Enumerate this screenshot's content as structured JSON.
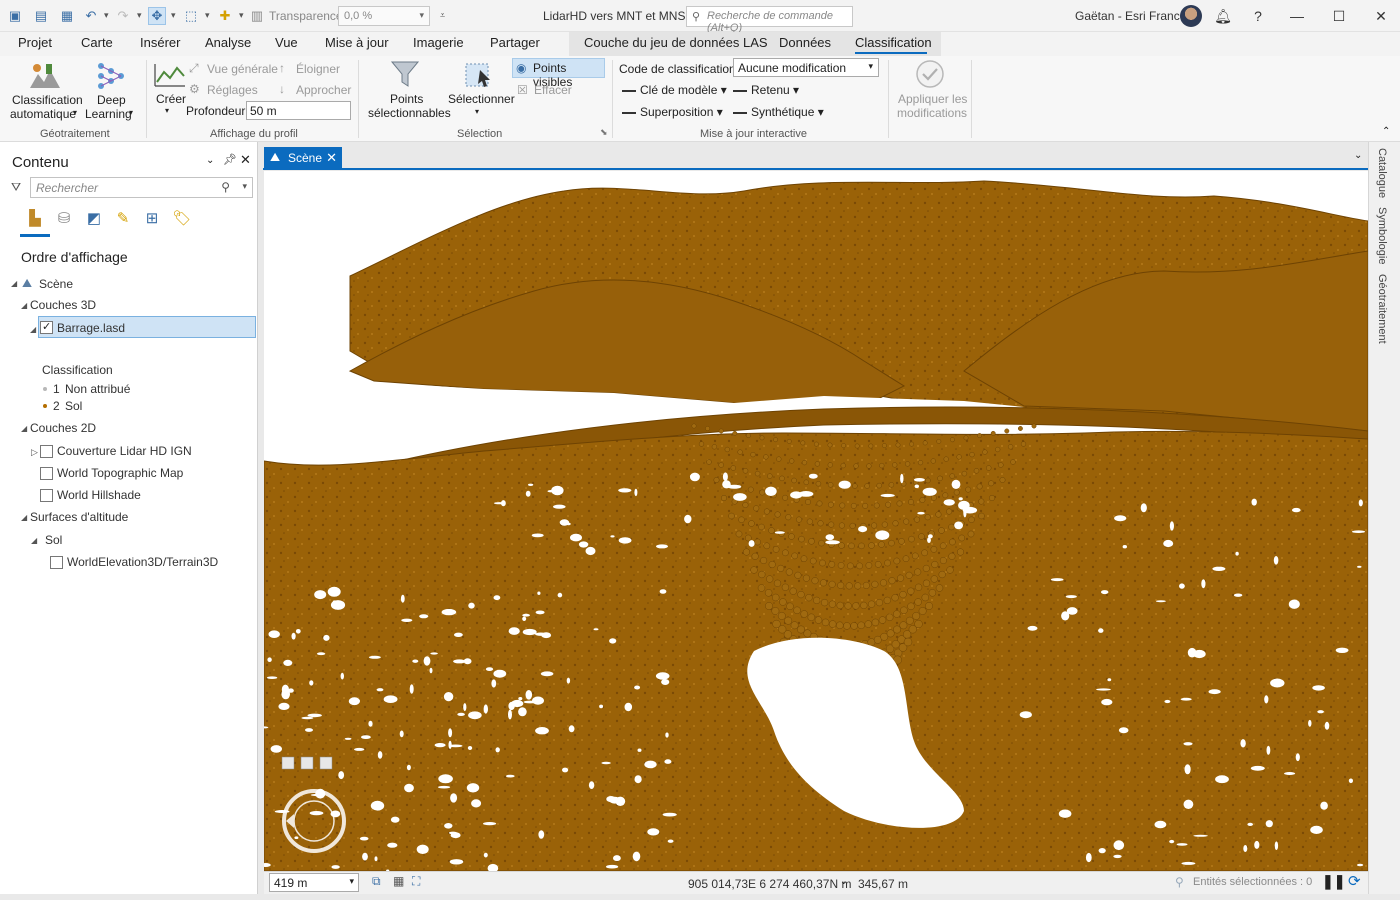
{
  "title_bar": {
    "transparency_label": "Transparence",
    "transparency_value": "0,0 %",
    "project_title": "LidarHD vers MNT et MNS",
    "command_search_placeholder": "Recherche de commande (Alt+Q)",
    "user_name": "Gaëtan - Esri France"
  },
  "ribbon_tabs": [
    "Projet",
    "Carte",
    "Insérer",
    "Analyse",
    "Vue",
    "Mise à jour",
    "Imagerie",
    "Partager",
    "Couche du jeu de données LAS",
    "Données",
    "Classification"
  ],
  "active_tab": "Classification",
  "ribbon": {
    "geotraitement": {
      "label": "Géotraitement",
      "auto_class_line1": "Classification",
      "auto_class_line2": "automatique",
      "deep_line1": "Deep",
      "deep_line2": "Learning"
    },
    "profil": {
      "label": "Affichage du profil",
      "create": "Créer",
      "overview": "Vue générale",
      "settings": "Réglages",
      "move_away": "Éloigner",
      "approach": "Approcher",
      "depth_label": "Profondeur",
      "depth_value": "50 m"
    },
    "selection": {
      "label": "Sélection",
      "selectable_line1": "Points",
      "selectable_line2": "sélectionnables",
      "select": "Sélectionner",
      "visible_points": "Points visibles",
      "clear": "Effacer"
    },
    "interactive": {
      "label": "Mise à jour interactive",
      "class_code_label": "Code de classification",
      "class_code_value": "Aucune modification",
      "model_key": "Clé de modèle",
      "overlap": "Superposition",
      "withheld": "Retenu",
      "synthetic": "Synthétique"
    },
    "apply": {
      "line1": "Appliquer les",
      "line2": "modifications"
    }
  },
  "contents": {
    "title": "Contenu",
    "search_placeholder": "Rechercher",
    "draw_order": "Ordre d'affichage",
    "scene": "Scène",
    "layers_3d": "Couches 3D",
    "las_layer": "Barrage.lasd",
    "classification_heading": "Classification",
    "classes": [
      {
        "code": "1",
        "name": "Non attribué",
        "color": "#b8b8b8"
      },
      {
        "code": "2",
        "name": "Sol",
        "color": "#b46e00"
      }
    ],
    "layers_2d": "Couches 2D",
    "layers_2d_items": [
      "Couverture Lidar HD IGN",
      "World Topographic Map",
      "World Hillshade"
    ],
    "elevation_surfaces": "Surfaces d'altitude",
    "ground": "Sol",
    "terrain": "WorldElevation3D/Terrain3D"
  },
  "view": {
    "tab_label": "Scène",
    "point_color": "#9a6208",
    "point_edge_color": "#6e4303"
  },
  "side_tabs": [
    "Catalogue",
    "Symbologie",
    "Géotraitement"
  ],
  "status_bar": {
    "scale": "419 m",
    "coordinates": "905 014,73E 6 274 460,37N m",
    "elevation": "345,67 m",
    "selected": "Entités sélectionnées : 0"
  }
}
